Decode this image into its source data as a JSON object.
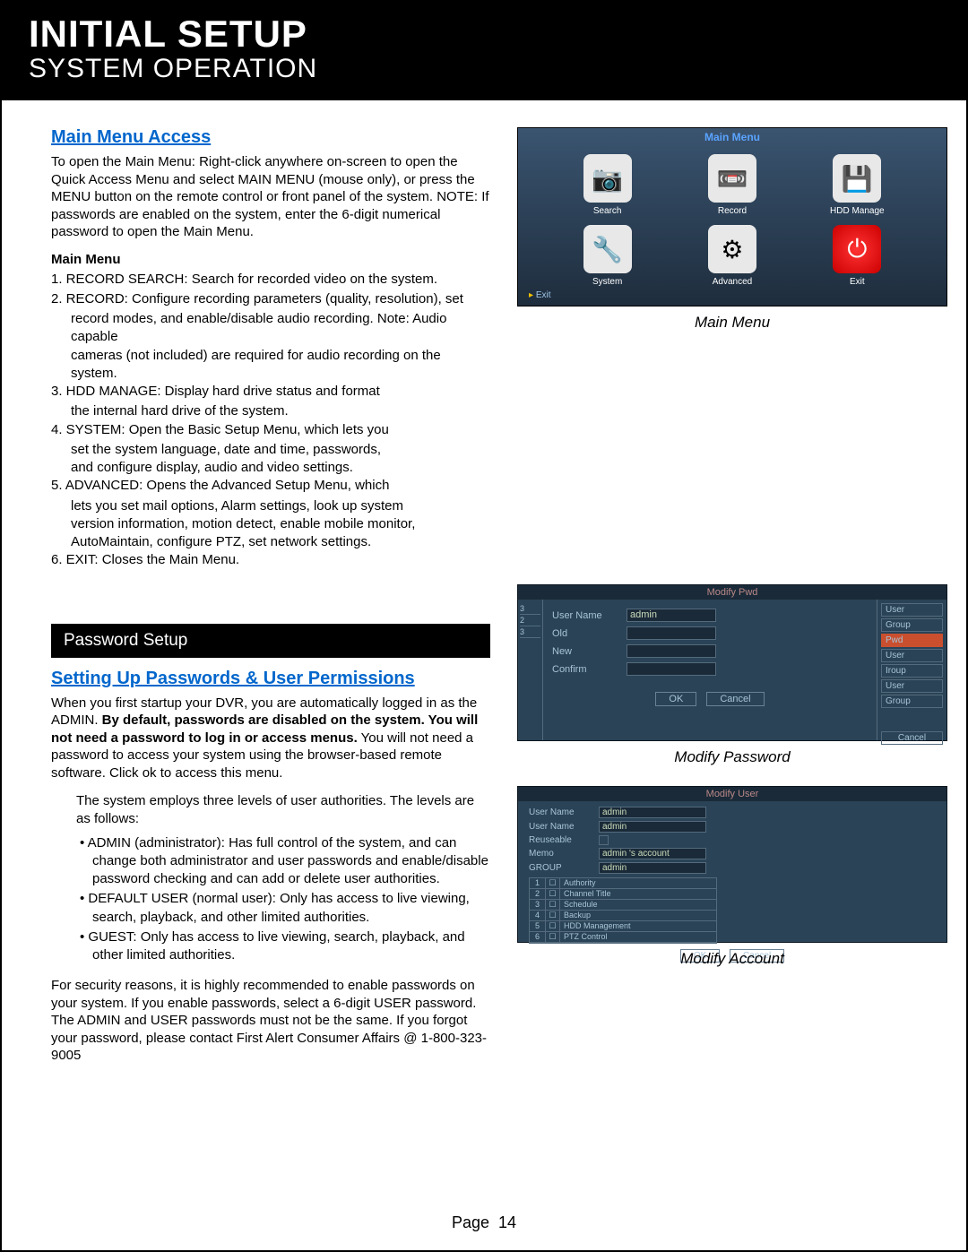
{
  "header": {
    "title": "INITIAL SETUP",
    "subtitle": "SYSTEM OPERATION"
  },
  "section1": {
    "heading": "Main Menu Access",
    "intro": "To open the Main Menu: Right-click anywhere on-screen to open the Quick Access Menu and select MAIN MENU (mouse only), or press the MENU button on the remote control or front panel of the system. NOTE: If passwords are enabled on the system, enter the 6-digit numerical password to open the Main Menu.",
    "subhead": "Main Menu",
    "items": [
      "1. RECORD SEARCH: Search for recorded video on the system.",
      "2. RECORD: Configure recording parameters (quality, resolution), set",
      "record modes, and enable/disable audio recording. Note: Audio capable",
      "cameras (not included) are required for audio recording on the system.",
      "3. HDD MANAGE: Display hard drive status and format",
      "the internal hard drive of the system.",
      "4. SYSTEM: Open the Basic Setup Menu, which lets you",
      "set the system language, date and time, passwords,",
      "and configure display, audio and video settings.",
      "5. ADVANCED: Opens the Advanced Setup Menu, which",
      "lets you set mail options, Alarm settings, look up system",
      "version information,  motion detect, enable mobile monitor,",
      "AutoMaintain, configure PTZ, set network settings.",
      "6. EXIT: Closes the Main Menu."
    ]
  },
  "sectionbar": "Password Setup",
  "section2": {
    "heading": "Setting Up Passwords & User Permissions",
    "p1": "When you first startup your DVR, you are automatically logged in as the ADMIN. ",
    "p1b": "By default, passwords are disabled on the system. You will not need a password to log in or access menus.",
    "p1c": " You will not need a password to access your system using the browser-based remote software. Click ok to access this menu.",
    "p2": "The system employs three levels of user authorities. The levels are as follows:",
    "bullets": [
      "• ADMIN (administrator): Has full control of the system, and can change both administrator and user passwords and enable/disable password checking and can add or delete user authorities.",
      "• DEFAULT USER (normal user): Only has access to live viewing, search, playback, and other limited authorities.",
      "• GUEST: Only has access to live viewing, search, playback, and other limited authorities."
    ],
    "p3": "For security reasons, it is highly recommended to enable passwords on your system. If you enable passwords, select a 6-digit USER password. The ADMIN and USER passwords must not be the same. If you forgot your password, please contact First Alert Consumer Affairs @ 1-800-323-9005"
  },
  "screenshots": {
    "mainmenu": {
      "title": "Main Menu",
      "icons": [
        {
          "label": "Search",
          "glyph": "📷"
        },
        {
          "label": "Record",
          "glyph": "📼"
        },
        {
          "label": "HDD Manage",
          "glyph": "💾"
        },
        {
          "label": "System",
          "glyph": "🔧"
        },
        {
          "label": "Advanced",
          "glyph": "⚙"
        },
        {
          "label": "Exit",
          "glyph": "⏻"
        }
      ],
      "exitlink": "Exit",
      "caption": "Main Menu"
    },
    "modpwd": {
      "title": "Modify Pwd",
      "left": [
        "3",
        "2",
        "3"
      ],
      "rows": [
        {
          "lbl": "User Name",
          "val": "admin"
        },
        {
          "lbl": "Old",
          "val": ""
        },
        {
          "lbl": "New",
          "val": ""
        },
        {
          "lbl": "Confirm",
          "val": ""
        }
      ],
      "btns": {
        "ok": "OK",
        "cancel": "Cancel"
      },
      "right": [
        "User",
        "Group",
        "Pwd",
        "User",
        "Iroup",
        "User",
        "Group"
      ],
      "rcancel": "Cancel",
      "caption": "Modify Password"
    },
    "modacc": {
      "title": "Modify User",
      "rows": [
        {
          "lbl": "User Name",
          "val": "admin"
        },
        {
          "lbl": "User Name",
          "val": "admin"
        },
        {
          "lbl": "Reuseable",
          "val": ""
        },
        {
          "lbl": "Memo",
          "val": "admin 's account"
        },
        {
          "lbl": "GROUP",
          "val": "admin"
        }
      ],
      "table": [
        {
          "n": "1",
          "auth": "Authority"
        },
        {
          "n": "2",
          "auth": "Channel Title"
        },
        {
          "n": "3",
          "auth": "Schedule"
        },
        {
          "n": "4",
          "auth": "Backup"
        },
        {
          "n": "5",
          "auth": "HDD Management"
        },
        {
          "n": "6",
          "auth": "PTZ Control"
        }
      ],
      "btns": {
        "ok": "OK",
        "cancel": "Cancel"
      },
      "caption": "Modify Account"
    }
  },
  "footer": {
    "page_label": "Page",
    "page_num": "14"
  }
}
